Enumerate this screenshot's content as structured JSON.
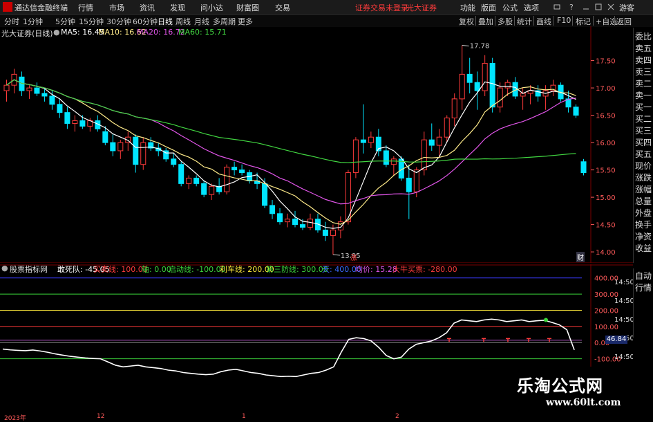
{
  "menubar": {
    "app_title": "通达信金融终端",
    "menus": [
      "行情",
      "市场",
      "资讯",
      "发现",
      "问小达",
      "财富圈",
      "交易"
    ],
    "notice": "证券交易未登录",
    "broker": "光大证券",
    "sys_items": [
      "功能",
      "版面",
      "公式",
      "选项"
    ],
    "login": "游客"
  },
  "periods": [
    "分时",
    "1分钟",
    "5分钟",
    "15分钟",
    "30分钟",
    "60分钟",
    "日线",
    "周线",
    "月线",
    "多周期",
    "更多"
  ],
  "active_period": "日线",
  "tools": [
    "复权",
    "叠加",
    "多股",
    "统计",
    "画线",
    "F10",
    "标记",
    "+自选",
    "返回"
  ],
  "main": {
    "stock_label": "光大证券(日线)",
    "ma": [
      {
        "label": "MA5: 16.45",
        "color": "#ffffff"
      },
      {
        "label": "MA10: 16.62",
        "color": "#ffeb8a"
      },
      {
        "label": "MA20: 16.72",
        "color": "#e055e8"
      },
      {
        "label": "MA60: 15.71",
        "color": "#41d641"
      }
    ],
    "price_axis": [
      "17.50",
      "17.00",
      "16.50",
      "16.00",
      "15.50",
      "15.00",
      "14.50",
      "14.00"
    ],
    "high_label": "17.78",
    "low_label": "13.95",
    "marker_zhang": "涨",
    "marker_cai": "财"
  },
  "side": [
    "委比",
    "卖五",
    "卖四",
    "卖三",
    "卖二",
    "卖一",
    "买一",
    "买二",
    "买三",
    "买四",
    "买五",
    "现价",
    "涨跌",
    "涨幅",
    "总量",
    "外盘",
    "换手",
    "净资",
    "收益"
  ],
  "indicator": {
    "name": "股票指标网",
    "items": [
      {
        "label": "敢死队: -45.05",
        "color": "#ffffff"
      },
      {
        "label": "买卖线: 100.00",
        "color": "#ff3b3b"
      },
      {
        "label": "轴: 0.00",
        "color": "#3bd63b"
      },
      {
        "label": "启动线: -100.00",
        "color": "#3bd63b"
      },
      {
        "label": "利车线: 200.00",
        "color": "#ffeb3b"
      },
      {
        "label": "第三防线: 300.00",
        "color": "#3bd63b"
      },
      {
        "label": "天: 400.00",
        "color": "#3b6bff"
      },
      {
        "label": "均价: 15.28",
        "color": "#e055e8"
      },
      {
        "label": "大牛买票: -280.00",
        "color": "#ff3b3b"
      }
    ],
    "axis": [
      "400.00",
      "300.00",
      "200.00",
      "100.00",
      "0.00",
      "-100.00"
    ],
    "current_value": "46.84",
    "side": [
      "自动",
      "行情"
    ],
    "time_labels": [
      "14:50",
      "14:50",
      "14:50",
      "14:50",
      "14:50",
      "14:50"
    ]
  },
  "time_axis": [
    "2023年",
    "12",
    "1",
    "2"
  ],
  "watermark": {
    "title": "乐淘公式网",
    "url": "www.60lt.com"
  },
  "chart_data": {
    "type": "candlestick",
    "candles": [
      [
        16.95,
        17.15,
        16.75,
        17.05
      ],
      [
        17.05,
        17.35,
        16.9,
        17.25
      ],
      [
        17.2,
        17.3,
        16.85,
        16.95
      ],
      [
        16.95,
        17.05,
        16.8,
        17.0
      ],
      [
        17.0,
        17.1,
        16.85,
        16.9
      ],
      [
        16.9,
        17.0,
        16.75,
        16.85
      ],
      [
        16.85,
        16.95,
        16.6,
        16.7
      ],
      [
        16.7,
        16.8,
        16.45,
        16.55
      ],
      [
        16.55,
        16.65,
        16.25,
        16.35
      ],
      [
        16.35,
        16.5,
        16.2,
        16.4
      ],
      [
        16.4,
        16.5,
        16.25,
        16.3
      ],
      [
        16.3,
        16.45,
        16.2,
        16.4
      ],
      [
        16.4,
        16.5,
        16.2,
        16.25
      ],
      [
        16.2,
        16.3,
        15.95,
        16.0
      ],
      [
        16.0,
        16.15,
        15.75,
        15.85
      ],
      [
        15.85,
        16.05,
        15.7,
        16.0
      ],
      [
        16.0,
        16.2,
        15.85,
        16.1
      ],
      [
        16.1,
        16.15,
        15.45,
        15.6
      ],
      [
        15.6,
        16.1,
        15.5,
        16.0
      ],
      [
        16.0,
        16.1,
        15.85,
        15.9
      ],
      [
        15.9,
        16.0,
        15.75,
        15.85
      ],
      [
        15.85,
        15.9,
        15.65,
        15.7
      ],
      [
        15.7,
        15.8,
        15.55,
        15.6
      ],
      [
        15.6,
        15.65,
        15.2,
        15.25
      ],
      [
        15.25,
        15.4,
        15.15,
        15.35
      ],
      [
        15.35,
        15.4,
        15.2,
        15.25
      ],
      [
        15.25,
        15.3,
        15.0,
        15.05
      ],
      [
        15.05,
        15.25,
        14.95,
        15.2
      ],
      [
        15.2,
        15.35,
        15.05,
        15.1
      ],
      [
        15.1,
        15.6,
        15.05,
        15.55
      ],
      [
        15.55,
        15.65,
        15.4,
        15.5
      ],
      [
        15.5,
        15.6,
        15.4,
        15.45
      ],
      [
        15.45,
        15.5,
        15.25,
        15.3
      ],
      [
        15.3,
        15.45,
        15.15,
        15.25
      ],
      [
        15.25,
        15.35,
        14.8,
        14.85
      ],
      [
        14.85,
        14.95,
        14.6,
        14.7
      ],
      [
        14.7,
        14.8,
        14.5,
        14.55
      ],
      [
        14.55,
        14.7,
        14.45,
        14.6
      ],
      [
        14.6,
        14.75,
        14.45,
        14.5
      ],
      [
        14.5,
        14.6,
        14.4,
        14.45
      ],
      [
        14.45,
        14.7,
        14.4,
        14.6
      ],
      [
        14.6,
        14.7,
        14.35,
        14.4
      ],
      [
        14.4,
        14.55,
        14.2,
        14.3
      ],
      [
        14.3,
        14.5,
        13.95,
        14.4
      ],
      [
        14.4,
        14.65,
        14.25,
        14.55
      ],
      [
        14.55,
        15.5,
        14.5,
        15.45
      ],
      [
        15.45,
        16.1,
        15.35,
        16.05
      ],
      [
        16.05,
        16.7,
        15.8,
        16.0
      ],
      [
        16.0,
        16.2,
        15.9,
        16.1
      ],
      [
        16.1,
        16.25,
        15.75,
        15.85
      ],
      [
        15.85,
        15.95,
        15.55,
        15.6
      ],
      [
        15.6,
        15.75,
        15.4,
        15.7
      ],
      [
        15.7,
        15.75,
        15.3,
        15.35
      ],
      [
        15.35,
        15.6,
        14.6,
        15.1
      ],
      [
        15.1,
        15.55,
        15.0,
        15.5
      ],
      [
        15.5,
        16.2,
        15.4,
        16.05
      ],
      [
        16.05,
        16.35,
        15.85,
        15.95
      ],
      [
        15.95,
        16.25,
        15.75,
        16.1
      ],
      [
        16.1,
        16.5,
        16.0,
        16.45
      ],
      [
        16.45,
        16.9,
        16.3,
        16.8
      ],
      [
        16.8,
        17.78,
        16.6,
        17.25
      ],
      [
        17.25,
        17.55,
        16.9,
        17.1
      ],
      [
        17.1,
        17.3,
        16.6,
        16.95
      ],
      [
        16.95,
        17.6,
        16.85,
        17.45
      ],
      [
        17.45,
        17.55,
        16.55,
        16.65
      ],
      [
        16.65,
        17.1,
        16.55,
        17.0
      ],
      [
        17.0,
        17.15,
        16.85,
        17.1
      ],
      [
        17.1,
        17.2,
        16.8,
        16.85
      ],
      [
        16.85,
        17.0,
        16.6,
        16.9
      ],
      [
        16.9,
        17.05,
        16.7,
        16.95
      ],
      [
        16.95,
        17.05,
        16.75,
        16.85
      ],
      [
        16.85,
        17.05,
        16.6,
        16.95
      ],
      [
        16.95,
        17.15,
        16.85,
        17.05
      ],
      [
        17.05,
        17.1,
        16.75,
        16.8
      ],
      [
        16.8,
        16.95,
        16.55,
        16.65
      ],
      [
        16.65,
        16.7,
        16.45,
        16.5
      ],
      [
        15.65,
        15.7,
        15.4,
        15.45
      ]
    ],
    "ylim": [
      13.9,
      17.9
    ],
    "indicator_series": {
      "white": [
        -40,
        -45,
        -48,
        -50,
        -46,
        -52,
        -60,
        -70,
        -78,
        -85,
        -90,
        -95,
        -98,
        -100,
        -120,
        -140,
        -150,
        -145,
        -140,
        -150,
        -155,
        -160,
        -170,
        -175,
        -185,
        -190,
        -195,
        -198,
        -195,
        -180,
        -170,
        -165,
        -175,
        -185,
        -190,
        -200,
        -205,
        -210,
        -208,
        -210,
        -200,
        -190,
        -185,
        -170,
        -150,
        -60,
        20,
        30,
        25,
        10,
        -30,
        -80,
        -100,
        -90,
        -40,
        -10,
        0,
        10,
        30,
        60,
        120,
        140,
        135,
        130,
        140,
        145,
        140,
        130,
        135,
        140,
        130,
        135,
        138,
        125,
        110,
        80,
        -45
      ],
      "ylim": [
        -200,
        450
      ]
    }
  }
}
